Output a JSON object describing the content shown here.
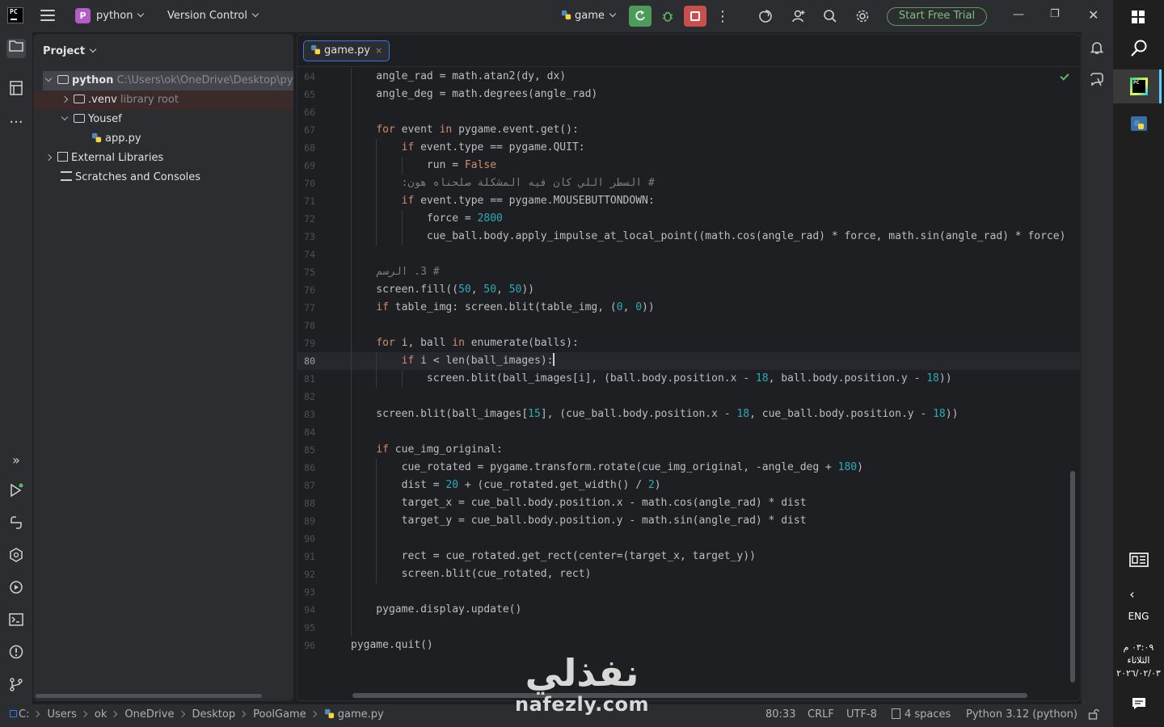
{
  "titlebar": {
    "project_badge": "P",
    "project_name": "python",
    "version_control": "Version Control",
    "run_config": "game",
    "trial_button": "Start Free Trial",
    "logo_text": "PC"
  },
  "project_panel": {
    "title": "Project",
    "tree": [
      {
        "name": "python",
        "hint": "C:\\Users\\ok\\OneDrive\\Desktop\\pyt"
      },
      {
        "name": ".venv",
        "hint": "library root"
      },
      {
        "name": "Yousef",
        "hint": ""
      },
      {
        "name": "app.py",
        "hint": ""
      },
      {
        "name": "External Libraries",
        "hint": ""
      },
      {
        "name": "Scratches and Consoles",
        "hint": ""
      }
    ]
  },
  "editor": {
    "tab_label": "game.py",
    "tab_close": "×",
    "current_line": 80
  },
  "code": [
    {
      "n": "64",
      "t": "    angle_rad = math.atan2(dy, dx)"
    },
    {
      "n": "65",
      "t": "    angle_deg = math.degrees(angle_rad)"
    },
    {
      "n": "66",
      "t": ""
    },
    {
      "n": "67",
      "t": "    for event in pygame.event.get():"
    },
    {
      "n": "68",
      "t": "        if event.type == pygame.QUIT:"
    },
    {
      "n": "69",
      "t": "            run = False"
    },
    {
      "n": "70",
      "t": "        # السطر اللي كان فيه المشكلة صلحناه هون:"
    },
    {
      "n": "71",
      "t": "        if event.type == pygame.MOUSEBUTTONDOWN:"
    },
    {
      "n": "72",
      "t": "            force = 2800"
    },
    {
      "n": "73",
      "t": "            cue_ball.body.apply_impulse_at_local_point((math.cos(angle_rad) * force, math.sin(angle_rad) * force)"
    },
    {
      "n": "74",
      "t": ""
    },
    {
      "n": "75",
      "t": "    # 3. الرسم"
    },
    {
      "n": "76",
      "t": "    screen.fill((50, 50, 50))"
    },
    {
      "n": "77",
      "t": "    if table_img: screen.blit(table_img, (0, 0))"
    },
    {
      "n": "78",
      "t": ""
    },
    {
      "n": "79",
      "t": "    for i, ball in enumerate(balls):"
    },
    {
      "n": "80",
      "t": "        if i < len(ball_images):"
    },
    {
      "n": "81",
      "t": "            screen.blit(ball_images[i], (ball.body.position.x - 18, ball.body.position.y - 18))"
    },
    {
      "n": "82",
      "t": ""
    },
    {
      "n": "83",
      "t": "    screen.blit(ball_images[15], (cue_ball.body.position.x - 18, cue_ball.body.position.y - 18))"
    },
    {
      "n": "84",
      "t": ""
    },
    {
      "n": "85",
      "t": "    if cue_img_original:"
    },
    {
      "n": "86",
      "t": "        cue_rotated = pygame.transform.rotate(cue_img_original, -angle_deg + 180)"
    },
    {
      "n": "87",
      "t": "        dist = 20 + (cue_rotated.get_width() / 2)"
    },
    {
      "n": "88",
      "t": "        target_x = cue_ball.body.position.x - math.cos(angle_rad) * dist"
    },
    {
      "n": "89",
      "t": "        target_y = cue_ball.body.position.y - math.sin(angle_rad) * dist"
    },
    {
      "n": "90",
      "t": ""
    },
    {
      "n": "91",
      "t": "        rect = cue_rotated.get_rect(center=(target_x, target_y))"
    },
    {
      "n": "92",
      "t": "        screen.blit(cue_rotated, rect)"
    },
    {
      "n": "93",
      "t": ""
    },
    {
      "n": "94",
      "t": "    pygame.display.update()"
    },
    {
      "n": "95",
      "t": ""
    },
    {
      "n": "96",
      "t": "pygame.quit()"
    }
  ],
  "statusbar": {
    "breadcrumb": [
      "C:",
      "Users",
      "ok",
      "OneDrive",
      "Desktop",
      "PoolGame",
      "game.py"
    ],
    "position": "80:33",
    "line_endings": "CRLF",
    "encoding": "UTF-8",
    "indent": "4 spaces",
    "interpreter": "Python 3.12 (python)"
  },
  "taskbar": {
    "language": "ENG",
    "time": "٠٣:٠٩ م",
    "day": "الثلاثاء",
    "date": "٢٠٢٦/٠٢/٠٣"
  },
  "watermark": {
    "arabic": "نفذلي",
    "latin": "nafezly.com"
  },
  "colors": {
    "accent": "#3574f0",
    "keyword": "#cf8e6d",
    "number": "#2aacb8",
    "comment": "#7a7e85",
    "run_green": "#4d9b5b",
    "stop_red": "#c94f4f"
  }
}
